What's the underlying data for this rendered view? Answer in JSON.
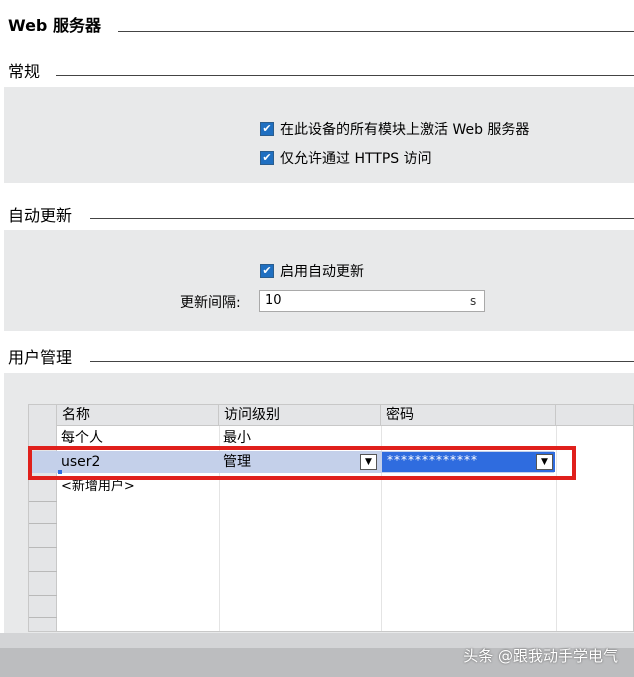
{
  "section_web": {
    "title": "Web 服务器"
  },
  "section_general": {
    "title": "常规",
    "activate_label": "在此设备的所有模块上激活 Web 服务器",
    "https_label": "仅允许通过 HTTPS 访问"
  },
  "section_autoupdate": {
    "title": "自动更新",
    "enable_label": "启用自动更新",
    "interval_label": "更新间隔:",
    "interval_value": "10",
    "interval_unit": "s"
  },
  "section_users": {
    "title": "用户管理",
    "columns": [
      "名称",
      "访问级别",
      "密码"
    ],
    "rows": [
      {
        "name": "每个人",
        "level": "最小",
        "password": ""
      },
      {
        "name": "user2",
        "level": "管理",
        "password": "*************"
      }
    ],
    "add_user": "<新增用户>"
  },
  "colors": {
    "highlight": "#e0201c",
    "selection": "#c4d0ea",
    "password_cell": "#2f6cdf"
  },
  "watermark": "头条 @跟我动手学电气"
}
